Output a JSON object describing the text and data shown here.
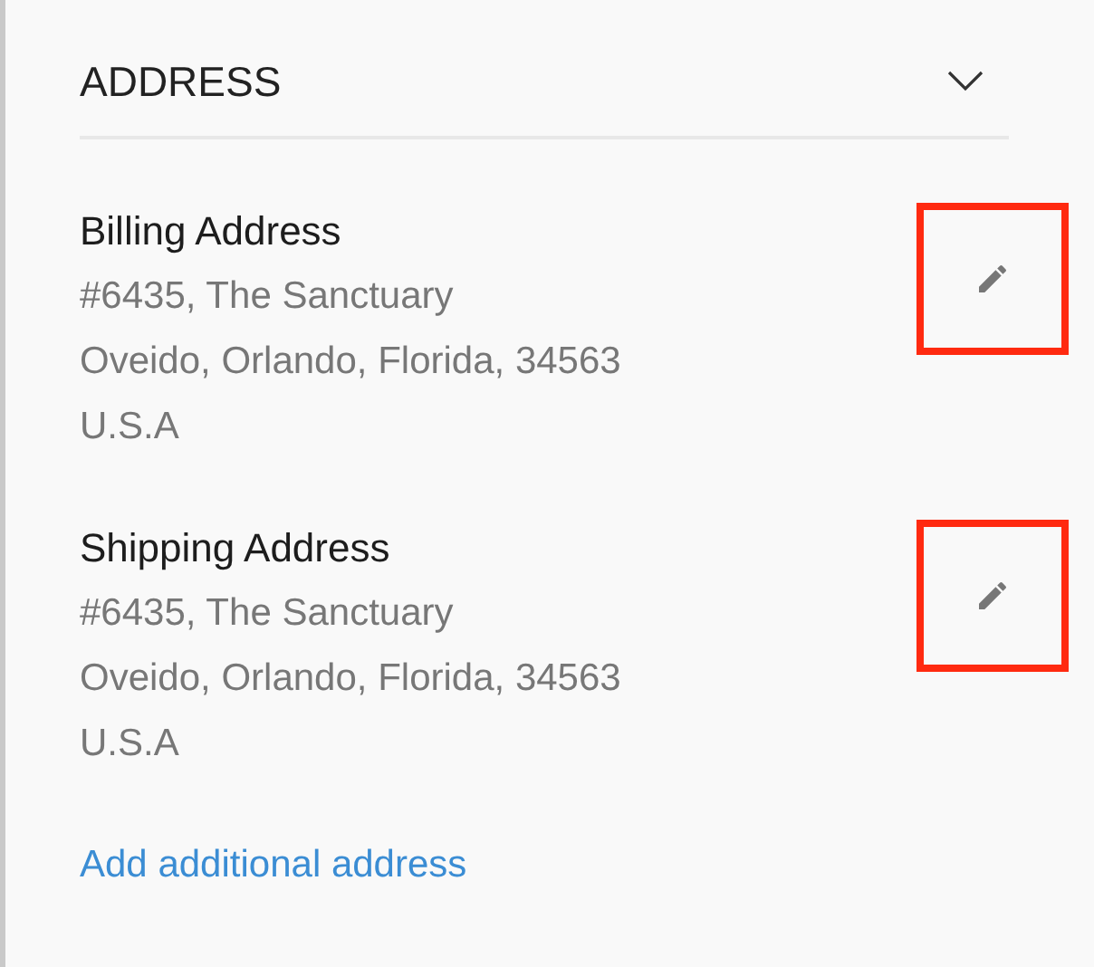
{
  "section": {
    "title": "ADDRESS",
    "expanded": true
  },
  "addresses": [
    {
      "title": "Billing Address",
      "lines": [
        "#6435, The Sanctuary",
        "Oveido, Orlando, Florida, 34563",
        "U.S.A"
      ],
      "highlighted": true
    },
    {
      "title": "Shipping Address",
      "lines": [
        "#6435, The Sanctuary",
        "Oveido, Orlando, Florida, 34563",
        "U.S.A"
      ],
      "highlighted": true
    }
  ],
  "add_link": "Add additional address"
}
